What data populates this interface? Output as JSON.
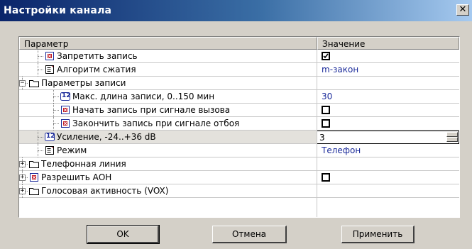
{
  "window": {
    "title": "Настройки канала",
    "close_glyph": "✕"
  },
  "grid": {
    "columns": [
      "Параметр",
      "Значение"
    ],
    "rows": [
      {
        "label": "Запретить запись",
        "value": "",
        "checkbox": true,
        "checked": true,
        "icon": "checkbox-param-icon"
      },
      {
        "label": "Алгоритм сжатия",
        "value": "m-закон",
        "icon": "list-param-icon"
      },
      {
        "label": "Параметры записи",
        "value": "",
        "icon": "folder-icon",
        "expander": "−"
      },
      {
        "label": "Макс. длина записи, 0..150 мин",
        "value": "30",
        "icon": "numeric-param-icon",
        "icon_text": "12"
      },
      {
        "label": "Начать запись при сигнале вызова",
        "value": "",
        "checkbox": true,
        "checked": false,
        "icon": "checkbox-param-icon"
      },
      {
        "label": "Закончить запись при сигнале отбоя",
        "value": "",
        "checkbox": true,
        "checked": false,
        "icon": "checkbox-param-icon"
      },
      {
        "label": "Усиление, -24..+36 dB",
        "value": "3",
        "editing": true,
        "icon": "numeric-param-icon",
        "icon_text": "12"
      },
      {
        "label": "Режим",
        "value": "Телефон",
        "icon": "list-param-icon"
      },
      {
        "label": "Телефонная линия",
        "value": "",
        "icon": "folder-icon",
        "expander": "+"
      },
      {
        "label": "Разрешить АОН",
        "value": "",
        "checkbox": true,
        "checked": false,
        "icon": "checkbox-param-icon",
        "expander": "+"
      },
      {
        "label": "Голосовая активность (VOX)",
        "value": "",
        "icon": "folder-icon",
        "expander": "+"
      }
    ]
  },
  "buttons": {
    "ok": "OK",
    "cancel": "Отмена",
    "apply": "Применить"
  }
}
